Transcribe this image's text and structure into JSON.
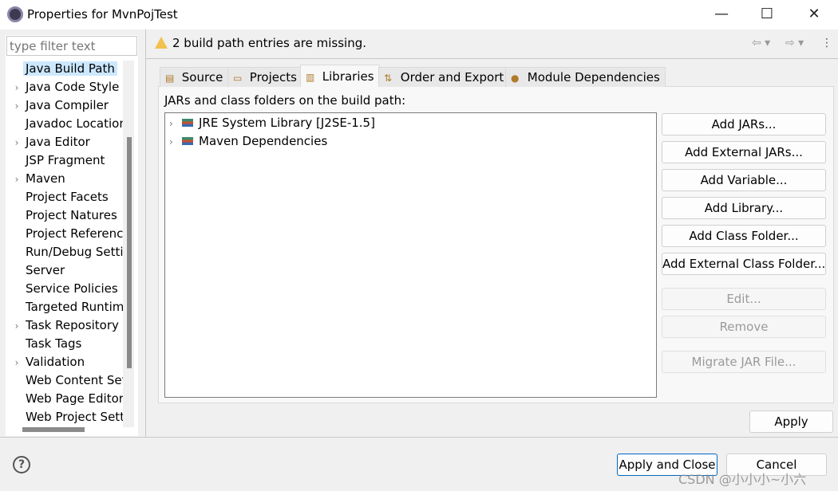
{
  "window": {
    "title": "Properties for MvnPojTest",
    "minimize": "—",
    "maximize": "☐",
    "close": "✕"
  },
  "sidebar": {
    "filter_placeholder": "type filter text",
    "items": [
      {
        "label": "Java Build Path",
        "expandable": false,
        "selected": true
      },
      {
        "label": "Java Code Style",
        "expandable": true
      },
      {
        "label": "Java Compiler",
        "expandable": true
      },
      {
        "label": "Javadoc Location",
        "expandable": false
      },
      {
        "label": "Java Editor",
        "expandable": true
      },
      {
        "label": "JSP Fragment",
        "expandable": false
      },
      {
        "label": "Maven",
        "expandable": true
      },
      {
        "label": "Project Facets",
        "expandable": false
      },
      {
        "label": "Project Natures",
        "expandable": false
      },
      {
        "label": "Project References",
        "expandable": false
      },
      {
        "label": "Run/Debug Settings",
        "expandable": false
      },
      {
        "label": "Server",
        "expandable": false
      },
      {
        "label": "Service Policies",
        "expandable": false
      },
      {
        "label": "Targeted Runtimes",
        "expandable": false
      },
      {
        "label": "Task Repository",
        "expandable": true
      },
      {
        "label": "Task Tags",
        "expandable": false
      },
      {
        "label": "Validation",
        "expandable": true
      },
      {
        "label": "Web Content Settings",
        "expandable": false
      },
      {
        "label": "Web Page Editor",
        "expandable": false
      },
      {
        "label": "Web Project Settings",
        "expandable": false
      }
    ]
  },
  "header": {
    "message": "2 build path entries are missing.",
    "icon": "warning-icon"
  },
  "tabs": [
    {
      "label": "Source",
      "icon": "source-folder-icon"
    },
    {
      "label": "Projects",
      "icon": "folder-icon"
    },
    {
      "label": "Libraries",
      "icon": "library-icon",
      "active": true
    },
    {
      "label": "Order and Export",
      "icon": "order-icon"
    },
    {
      "label": "Module Dependencies",
      "icon": "module-icon"
    }
  ],
  "libraries": {
    "label": "JARs and class folders on the build path:",
    "entries": [
      "JRE System Library [J2SE-1.5]",
      "Maven Dependencies"
    ]
  },
  "buttons": [
    {
      "label": "Add JARs...",
      "enabled": true
    },
    {
      "label": "Add External JARs...",
      "enabled": true
    },
    {
      "label": "Add Variable...",
      "enabled": true
    },
    {
      "label": "Add Library...",
      "enabled": true
    },
    {
      "label": "Add Class Folder...",
      "enabled": true
    },
    {
      "label": "Add External Class Folder...",
      "enabled": true
    },
    {
      "label": "Edit...",
      "enabled": false
    },
    {
      "label": "Remove",
      "enabled": false
    },
    {
      "label": "Migrate JAR File...",
      "enabled": false
    }
  ],
  "footer": {
    "apply": "Apply",
    "apply_and_close": "Apply and Close",
    "cancel": "Cancel",
    "help": "?"
  },
  "watermark": "CSDN @小小小~小六"
}
